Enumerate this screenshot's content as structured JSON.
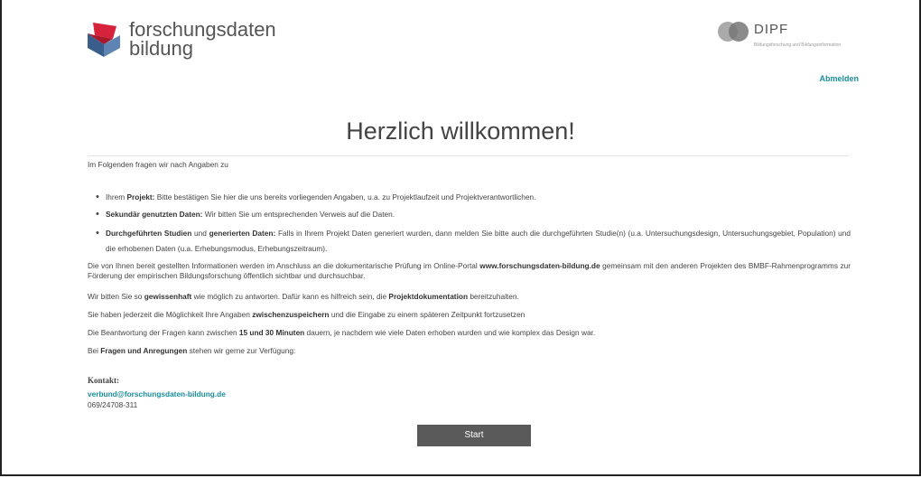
{
  "header": {
    "logo_line1": "forschungsdaten",
    "logo_line2": "bildung",
    "partner_title": "DIPF",
    "partner_subtitle": "Bildungsforschung und Bildungsinformation",
    "logout_label": "Abmelden"
  },
  "main": {
    "heading": "Herzlich willkommen!",
    "intro": "Im Folgenden fragen wir nach Angaben zu",
    "bullets": [
      {
        "bold": "Projekt:",
        "prefix": "Ihrem ",
        "text": " Bitte bestätigen Sie hier die uns bereits vorliegenden Angaben, u.a. zu Projektlaufzeit und Projektverantwortlichen."
      },
      {
        "bold": "Sekundär genutzten Daten:",
        "text": " Wir bitten Sie um entsprechenden Verweis auf die Daten."
      },
      {
        "bold": "Durchgeführten Studien",
        "mid": " und ",
        "bold2": "generierten Daten:",
        "text": " Falls in Ihrem Projekt Daten generiert wurden, dann melden Sie bitte auch die durchgeführten Studie(n) (u.a. Untersuchungsdesign, Untersuchungsgebiet, Population) und die erhobenen Daten (u.a. Erhebungsmodus, Erhebungszeitraum)."
      }
    ],
    "para1_a": "Die von Ihnen bereit gestellten Informationen werden im Anschluss an die dokumentarische Prüfung im Online-Portal ",
    "para1_link": "www.forschungsdaten-bildung.de",
    "para1_b": " gemeinsam mit den anderen Projekten des BMBF-Rahmenprogramms zur Förderung der empirischen Bildungsforschung öffentlich sichtbar und durchsuchbar.",
    "para2_a": "Wir bitten Sie so ",
    "para2_bold": "gewissenhaft",
    "para2_b": " wie möglich zu antworten. Dafür kann es hilfreich sein, die ",
    "para2_bold2": "Projektdokumentation",
    "para2_c": " bereitzuhalten.",
    "para3_a": "Sie haben jederzeit die Möglichkeit Ihre Angaben ",
    "para3_bold": "zwischenzuspeichern",
    "para3_b": " und die Eingabe zu einem späteren Zeitpunkt fortzusetzen",
    "para4_a": "Die Beantwortung der Fragen kann zwischen ",
    "para4_bold": "15 und 30 Minuten",
    "para4_b": " dauern, je nachdem wie viele Daten erhoben wurden und wie komplex das Design war.",
    "para5_a": "Bei ",
    "para5_bold": "Fragen und Anregungen",
    "para5_b": " stehen wir gerne zur Verfügung:",
    "contact_label": "Kontakt:",
    "contact_email": "verbund@forschungsdaten-bildung.de",
    "contact_phone": "069/24708-311",
    "start_label": "Start"
  },
  "colors": {
    "accent": "#1b8d9a",
    "logo_red": "#d6223a",
    "logo_blue": "#3a5e8c",
    "button": "#5a5a5a"
  }
}
